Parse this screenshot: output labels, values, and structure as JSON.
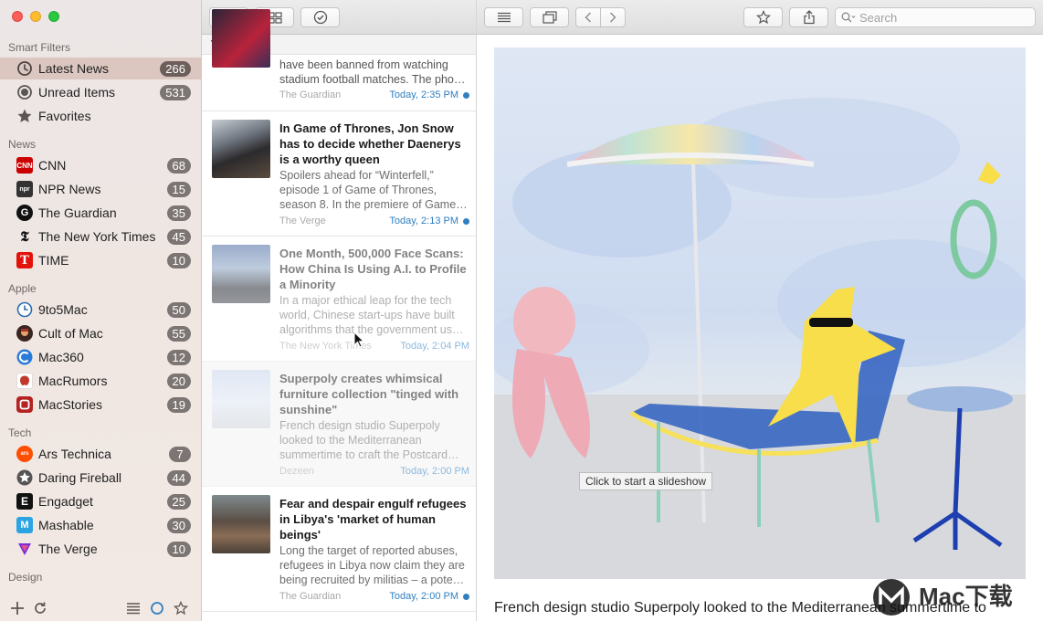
{
  "sidebar": {
    "sections": {
      "smart": "Smart Filters",
      "news": "News",
      "apple": "Apple",
      "tech": "Tech",
      "design": "Design"
    },
    "smart_items": [
      {
        "label": "Latest News",
        "count": "266",
        "icon": "clock-icon"
      },
      {
        "label": "Unread Items",
        "count": "531",
        "icon": "circle-icon"
      },
      {
        "label": "Favorites",
        "count": "",
        "icon": "star-icon"
      }
    ],
    "news_items": [
      {
        "label": "CNN",
        "count": "68",
        "icon": "cnn-icon",
        "color": "#cc0000"
      },
      {
        "label": "NPR News",
        "count": "15",
        "icon": "npr-icon",
        "color": "#333333"
      },
      {
        "label": "The Guardian",
        "count": "35",
        "icon": "guardian-icon",
        "color": "#111111"
      },
      {
        "label": "The New York Times",
        "count": "45",
        "icon": "nyt-icon",
        "color": "#111111"
      },
      {
        "label": "TIME",
        "count": "10",
        "icon": "time-icon",
        "color": "#e3120b"
      }
    ],
    "apple_items": [
      {
        "label": "9to5Mac",
        "count": "50",
        "icon": "9to5mac-icon",
        "color": "#2b6cb0"
      },
      {
        "label": "Cult of Mac",
        "count": "55",
        "icon": "cultofmac-icon",
        "color": "#a33226"
      },
      {
        "label": "Mac360",
        "count": "12",
        "icon": "mac360-icon",
        "color": "#2a7bd8"
      },
      {
        "label": "MacRumors",
        "count": "20",
        "icon": "macrumors-icon",
        "color": "#c0392b"
      },
      {
        "label": "MacStories",
        "count": "19",
        "icon": "macstories-icon",
        "color": "#b42222"
      }
    ],
    "tech_items": [
      {
        "label": "Ars Technica",
        "count": "7",
        "icon": "arstechnica-icon",
        "color": "#ff4e00"
      },
      {
        "label": "Daring Fireball",
        "count": "44",
        "icon": "daringfireball-icon",
        "color": "#555555"
      },
      {
        "label": "Engadget",
        "count": "25",
        "icon": "engadget-icon",
        "color": "#111111"
      },
      {
        "label": "Mashable",
        "count": "30",
        "icon": "mashable-icon",
        "color": "#2aa4e3"
      },
      {
        "label": "The Verge",
        "count": "10",
        "icon": "verge-icon",
        "color": "#7a2fd6"
      }
    ]
  },
  "list": {
    "day": "Today",
    "articles": [
      {
        "title": "",
        "body": "have been banned from watching stadium football matches. The pho…",
        "source": "The Guardian",
        "time": "Today, 2:35 PM",
        "unread": true
      },
      {
        "title": "In Game of Thrones, Jon Snow has to decide whether Daenerys is a worthy queen",
        "body": "Spoilers ahead for “Winterfell,” episode 1 of Game of Thrones, season 8. In the premiere of Game…",
        "source": "The Verge",
        "time": "Today, 2:13 PM",
        "unread": true
      },
      {
        "title": "One Month, 500,000 Face Scans: How China Is Using A.I. to Profile a Minority",
        "body": "In a major ethical leap for the tech world, Chinese start-ups have built algorithms that the government us…",
        "source": "The New York Times",
        "time": "Today, 2:04 PM",
        "unread": false
      },
      {
        "title": "Superpoly creates whimsical furniture collection \"tinged with sunshine\"",
        "body": "French design studio Superpoly looked to the Mediterranean summertime to craft the Postcard…",
        "source": "Dezeen",
        "time": "Today, 2:00 PM",
        "unread": false
      },
      {
        "title": "Fear and despair engulf refugees in Libya's 'market of human beings'",
        "body": "Long the target of reported abuses, refugees in Libya now claim they are being recruited by militias – a pote…",
        "source": "The Guardian",
        "time": "Today, 2:00 PM",
        "unread": true
      }
    ]
  },
  "reader": {
    "search_placeholder": "Search",
    "slideshow_tip": "Click to start a slideshow",
    "caption": "French design studio Superpoly looked to the Mediterranean summertime to",
    "watermark": "Mac下载"
  }
}
